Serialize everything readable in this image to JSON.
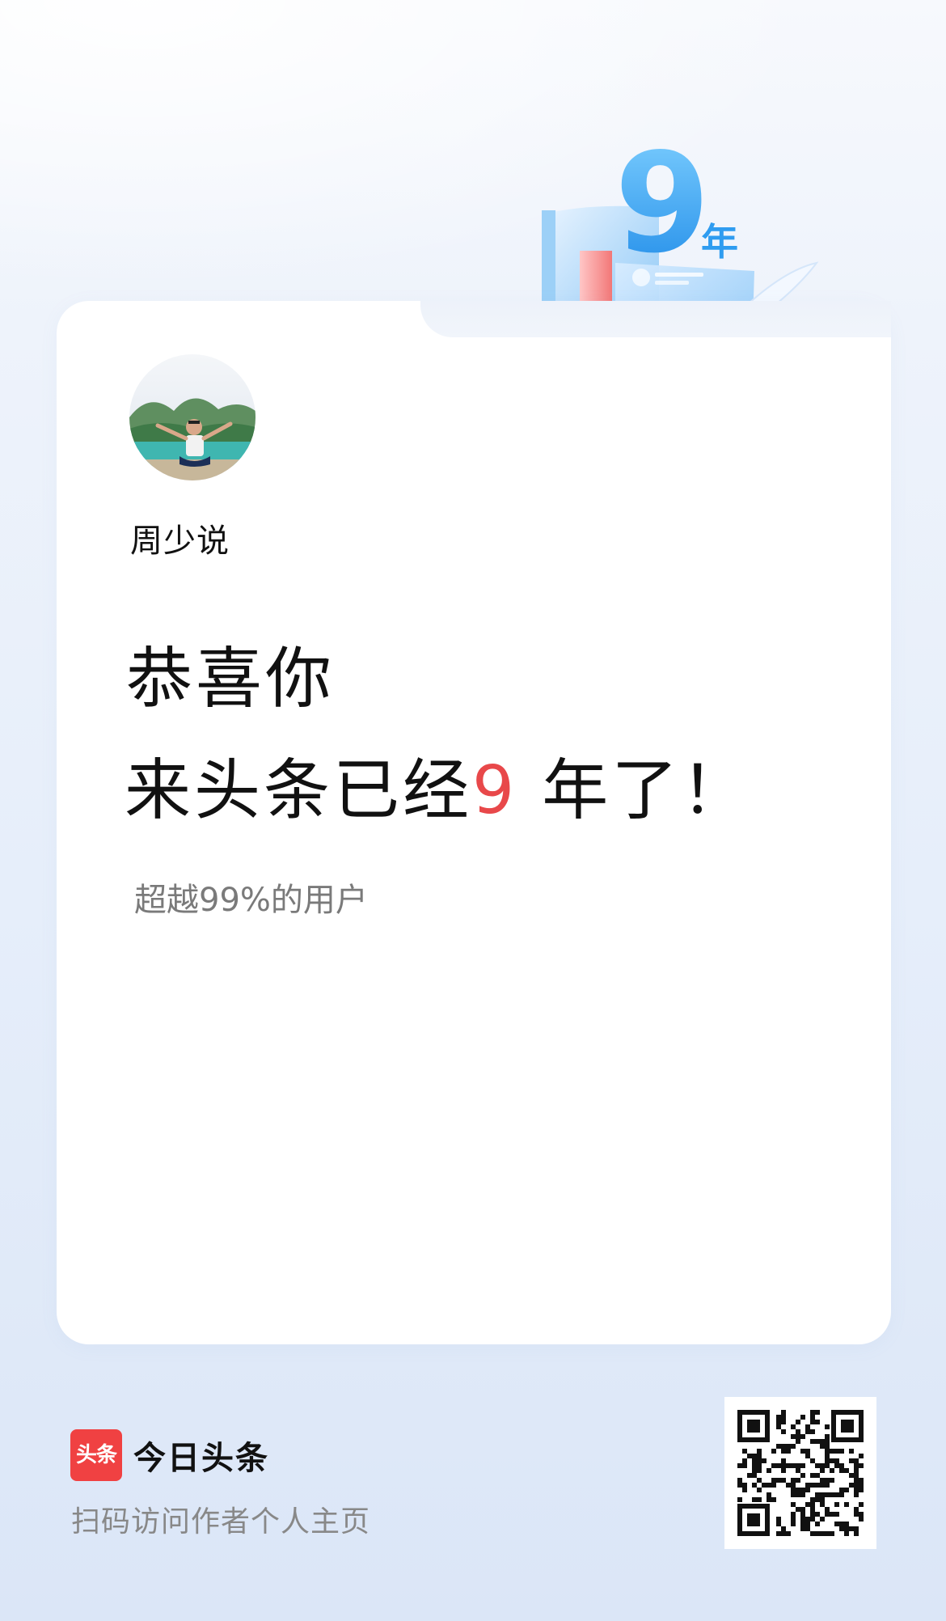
{
  "badge": {
    "number": "9",
    "unit": "年"
  },
  "profile": {
    "username": "周少说"
  },
  "message": {
    "line1": "恭喜你",
    "line2_prefix": "来头条已经",
    "years": "9",
    "line2_suffix": " 年了！",
    "rank": "超越99%的用户"
  },
  "footer": {
    "logo_text": "头条",
    "brand": "今日头条",
    "scan_hint": "扫码访问作者个人主页"
  },
  "colors": {
    "accent_red": "#e8484a",
    "brand_red": "#f04142",
    "badge_blue": "#2f9cf0"
  }
}
